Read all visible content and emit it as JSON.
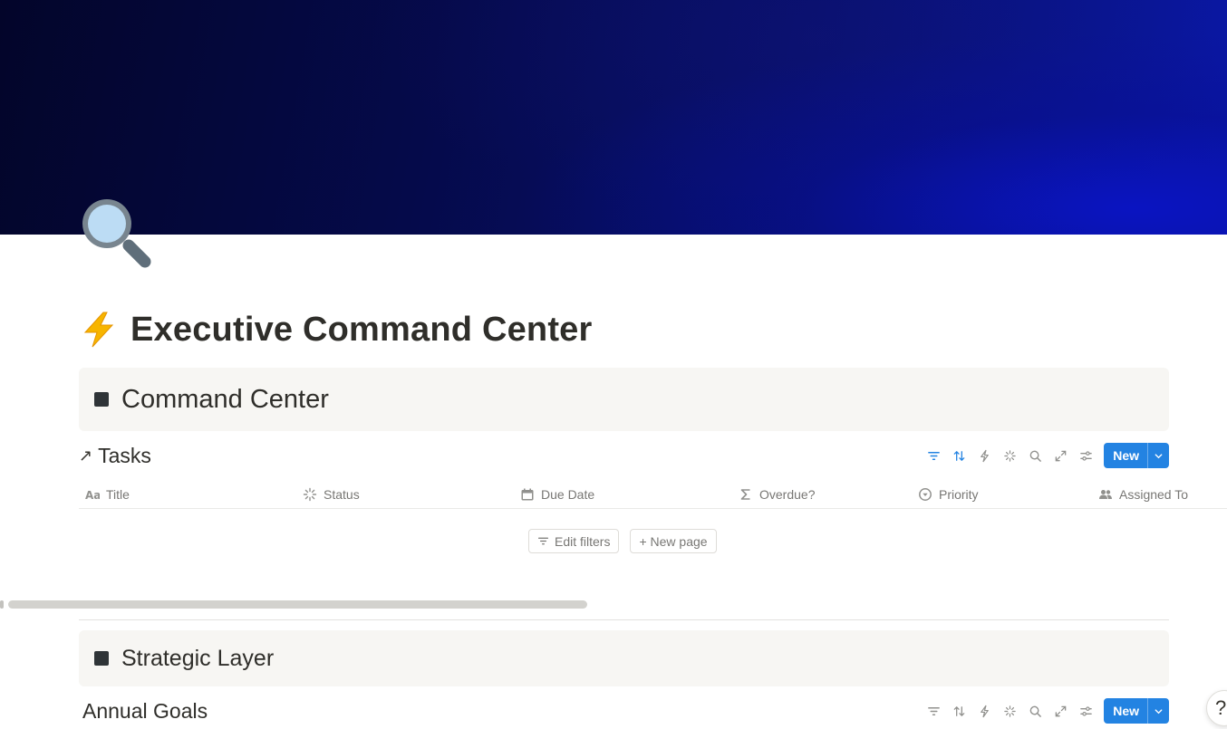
{
  "page": {
    "title": "Executive Command Center",
    "title_emoji": "lightning-icon",
    "page_icon": "magnifying-glass-icon"
  },
  "sections": [
    {
      "heading": "Command Center",
      "database": {
        "title": "Tasks",
        "link_icon": "arrow-up-right-icon",
        "columns": [
          {
            "label": "Title",
            "icon": "text-aa-icon"
          },
          {
            "label": "Status",
            "icon": "status-spinner-icon"
          },
          {
            "label": "Due Date",
            "icon": "calendar-icon"
          },
          {
            "label": "Overdue?",
            "icon": "sigma-icon"
          },
          {
            "label": "Priority",
            "icon": "select-circle-icon"
          },
          {
            "label": "Assigned To",
            "icon": "people-icon"
          }
        ],
        "empty_actions": {
          "edit_filters": "Edit filters",
          "new_page": "+ New page"
        },
        "new_button": "New"
      }
    },
    {
      "heading": "Strategic Layer",
      "database": {
        "title": "Annual Goals",
        "new_button": "New"
      }
    }
  ],
  "toolbar_icons": [
    "filter-icon",
    "sort-icon",
    "automation-icon",
    "ai-sparkle-icon",
    "search-icon",
    "expand-icon",
    "settings-icon"
  ],
  "help_button": "?",
  "colors": {
    "accent": "#2383e2",
    "active_toolbar_icon": "#2383e2",
    "callout_bg": "#f7f6f3",
    "cover_dark": "#03052a",
    "cover_bright": "#0a18a8"
  }
}
